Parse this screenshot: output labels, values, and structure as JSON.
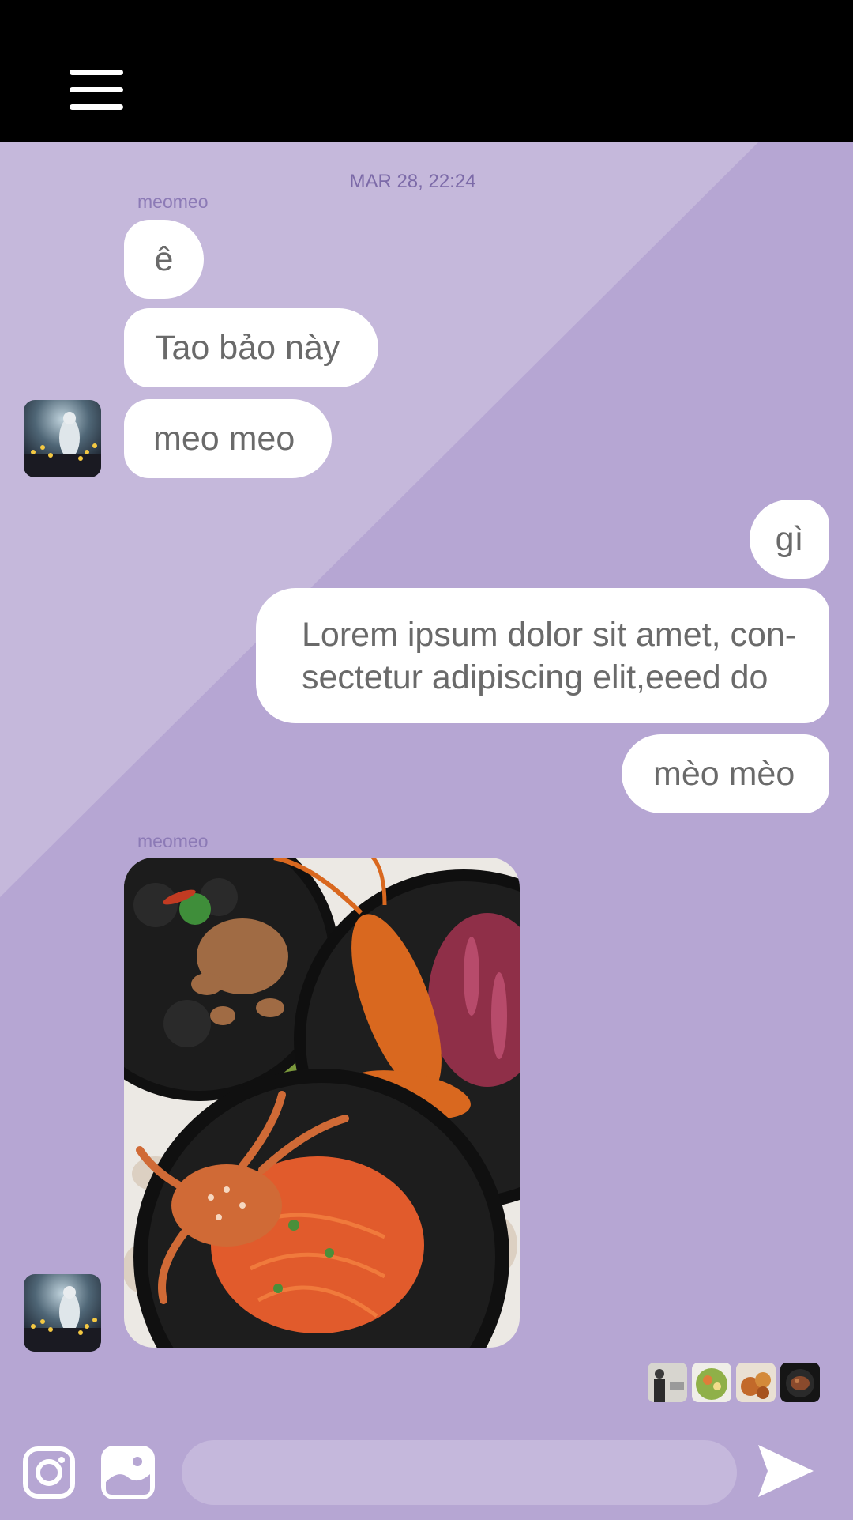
{
  "header": {
    "menu_icon": "hamburger-menu-icon"
  },
  "chat": {
    "timestamp": "MAR 28, 22:24",
    "groups": [
      {
        "sender": "meomeo",
        "direction": "incoming",
        "messages": [
          "ê",
          "Tao bảo này",
          "meo meo"
        ]
      },
      {
        "direction": "outgoing",
        "messages": [
          "gì",
          "Lorem ipsum dolor sit amet, con-\nsectetur adipiscing elit,eeed do",
          "mèo mèo"
        ]
      },
      {
        "sender": "meomeo",
        "direction": "incoming",
        "attachment": "food-photo"
      }
    ]
  },
  "composer": {
    "instagram_icon": "instagram-icon",
    "gallery_icon": "gallery-icon",
    "send_icon": "send-icon",
    "placeholder": "",
    "value": ""
  },
  "colors": {
    "topbar": "#000000",
    "background": "#b6a6d3",
    "background_light": "#c5b8db",
    "bubble": "#ffffff",
    "text": "#6a6a6a",
    "meta_text": "#7c6aa8"
  }
}
